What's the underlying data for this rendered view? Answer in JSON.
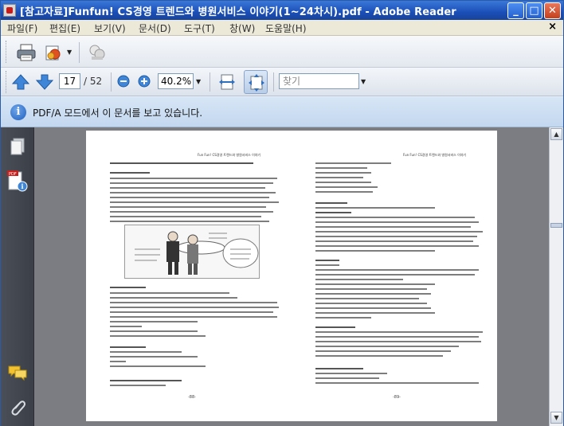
{
  "window": {
    "title": "[참고자료]Funfun! CS경영 트렌드와 병원서비스 이야기(1~24차시).pdf - Adobe Reader"
  },
  "menu": {
    "items": [
      "파일(F)",
      "편집(E)",
      "보기(V)",
      "문서(D)",
      "도구(T)",
      "창(W)",
      "도움말(H)"
    ],
    "close_glyph": "×"
  },
  "toolbar": {
    "current_page": "17",
    "page_separator": "/ 52",
    "zoom": "40.2%",
    "find_placeholder": "찾기"
  },
  "messagebar": {
    "icon_glyph": "i",
    "text": "PDF/A 모드에서 이 문서를 보고 있습니다."
  },
  "page": {
    "left_header": "Fun Fun! CS경영 트렌드와 병원서비스 이야기",
    "right_header": "Fun Fun! CS경영 트렌드와 병원서비스 이야기",
    "left_number": "-88-",
    "right_number": "-89-"
  },
  "colors": {
    "titlebar": "#1b4fb8",
    "messagebar": "#c3d7ef",
    "navigation_pane": "#3b3f47",
    "document_background": "#7b7d82"
  },
  "icons": {
    "print": "printer-icon",
    "export": "export-icon",
    "share": "collaborate-icon",
    "prev": "up-arrow-icon",
    "next": "down-arrow-icon",
    "zoom_out": "zoom-out-icon",
    "zoom_in": "zoom-in-icon",
    "fit_width": "fit-width-icon",
    "fit_page": "fit-page-icon",
    "pages": "pages-panel-icon",
    "attachments": "attachments-icon"
  }
}
